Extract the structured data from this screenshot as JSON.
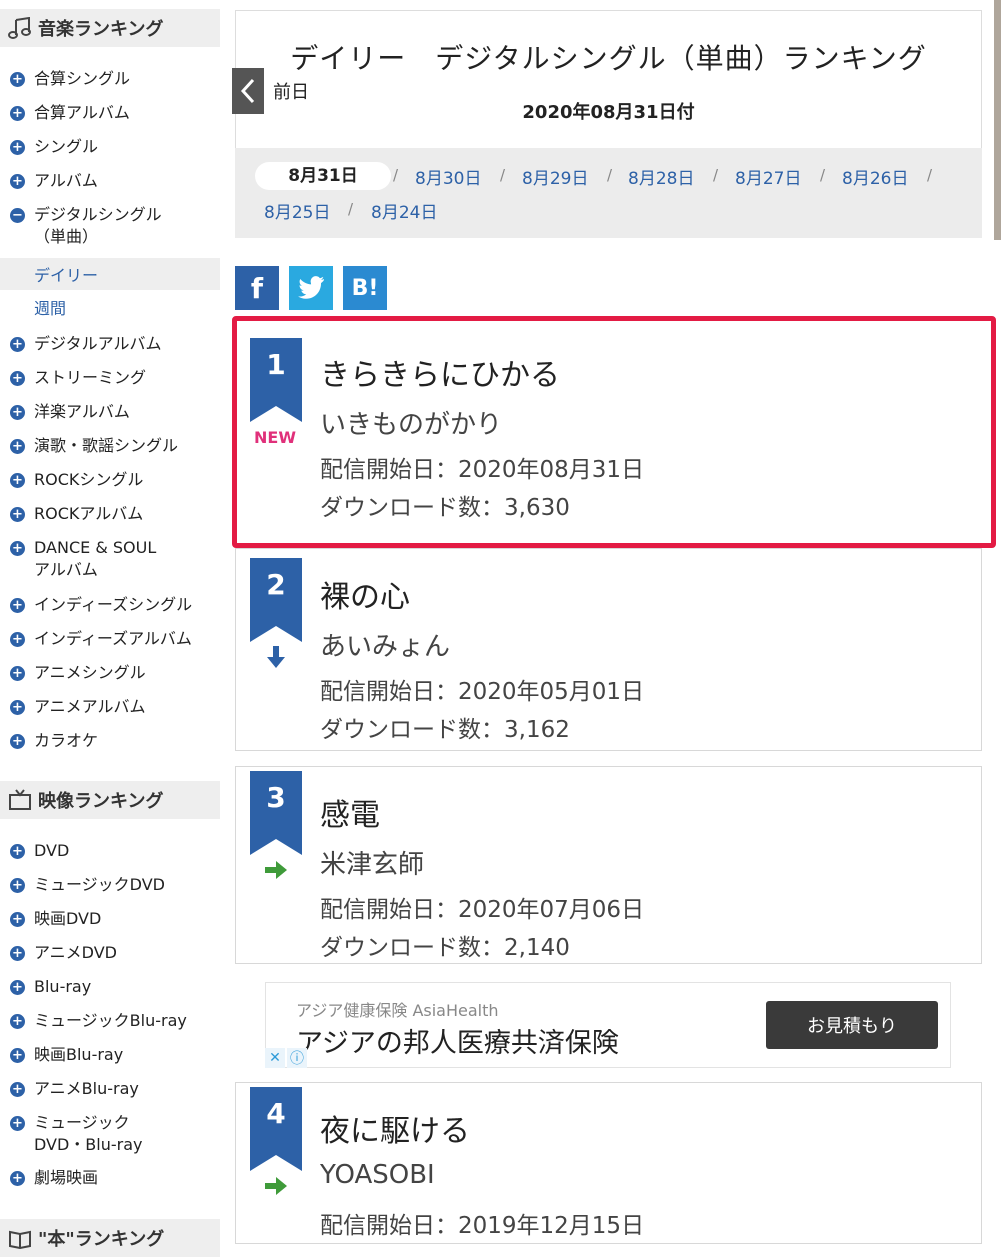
{
  "sidebar": {
    "music_heading": "音楽ランキング",
    "music_items": [
      {
        "label": "合算シングル",
        "icon": "plus"
      },
      {
        "label": "合算アルバム",
        "icon": "plus"
      },
      {
        "label": "シングル",
        "icon": "plus"
      },
      {
        "label": "アルバム",
        "icon": "plus"
      },
      {
        "label": "デジタルシングル\n（単曲）",
        "icon": "minus"
      }
    ],
    "sub_items": [
      {
        "label": "デイリー",
        "active": true
      },
      {
        "label": "週間",
        "active": false
      }
    ],
    "music_items_2": [
      {
        "label": "デジタルアルバム"
      },
      {
        "label": "ストリーミング"
      },
      {
        "label": "洋楽アルバム"
      },
      {
        "label": "演歌・歌謡シングル"
      },
      {
        "label": "ROCKシングル"
      },
      {
        "label": "ROCKアルバム"
      },
      {
        "label": "DANCE & SOUL\nアルバム"
      },
      {
        "label": "インディーズシングル"
      },
      {
        "label": "インディーズアルバム"
      },
      {
        "label": "アニメシングル"
      },
      {
        "label": "アニメアルバム"
      },
      {
        "label": "カラオケ"
      }
    ],
    "video_heading": "映像ランキング",
    "video_items": [
      {
        "label": "DVD"
      },
      {
        "label": "ミュージックDVD"
      },
      {
        "label": "映画DVD"
      },
      {
        "label": "アニメDVD"
      },
      {
        "label": "Blu-ray"
      },
      {
        "label": "ミュージックBlu-ray"
      },
      {
        "label": "映画Blu-ray"
      },
      {
        "label": "アニメBlu-ray"
      },
      {
        "label": "ミュージック\nDVD・Blu-ray"
      },
      {
        "label": "劇場映画"
      }
    ],
    "book_heading": "\"本\"ランキング"
  },
  "header": {
    "title": "デイリー　デジタルシングル（単曲）ランキング",
    "prev_label": "前日",
    "date_label": "2020年08月31日付"
  },
  "date_nav": [
    "8月31日",
    "8月30日",
    "8月29日",
    "8月28日",
    "8月27日",
    "8月26日",
    "8月25日",
    "8月24日"
  ],
  "date_nav_active": "8月31日",
  "date_sep": "/",
  "share": {
    "facebook": "f",
    "twitter": "twitter-bird",
    "hatena": "B!"
  },
  "rankings": [
    {
      "rank": "1",
      "status": "NEW",
      "title": "きらきらにひかる",
      "artist": "いきものがかり",
      "date": "配信開始日：2020年08月31日",
      "downloads": "ダウンロード数：3,630",
      "highlight": true
    },
    {
      "rank": "2",
      "status": "down",
      "title": "裸の心",
      "artist": "あいみょん",
      "date": "配信開始日：2020年05月01日",
      "downloads": "ダウンロード数：3,162"
    },
    {
      "rank": "3",
      "status": "same",
      "title": "感電",
      "artist": "米津玄師",
      "date": "配信開始日：2020年07月06日",
      "downloads": "ダウンロード数：2,140"
    },
    {
      "rank": "4",
      "status": "same",
      "title": "夜に駆ける",
      "artist": "YOASOBI",
      "date": "配信開始日：2019年12月15日"
    }
  ],
  "ad": {
    "sponsor": "アジア健康保険 AsiaHealth",
    "headline": "アジアの邦人医療共済保険",
    "button": "お見積もり"
  },
  "colors": {
    "brand_blue": "#2d61a7",
    "highlight_red": "#e31b44",
    "new_pink": "#e0307a",
    "arrow_green": "#3f9b3a"
  }
}
